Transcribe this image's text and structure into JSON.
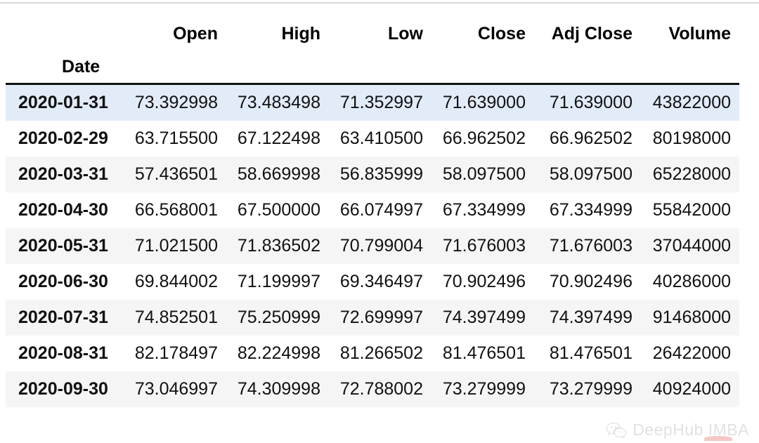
{
  "table": {
    "index_name": "Date",
    "columns": [
      "Open",
      "High",
      "Low",
      "Close",
      "Adj Close",
      "Volume"
    ],
    "rows": [
      {
        "date": "2020-01-31",
        "open": "73.392998",
        "high": "73.483498",
        "low": "71.352997",
        "close": "71.639000",
        "adj_close": "71.639000",
        "volume": "43822000",
        "style": "highlight"
      },
      {
        "date": "2020-02-29",
        "open": "63.715500",
        "high": "67.122498",
        "low": "63.410500",
        "close": "66.962502",
        "adj_close": "66.962502",
        "volume": "80198000",
        "style": "plain"
      },
      {
        "date": "2020-03-31",
        "open": "57.436501",
        "high": "58.669998",
        "low": "56.835999",
        "close": "58.097500",
        "adj_close": "58.097500",
        "volume": "65228000",
        "style": "stripe"
      },
      {
        "date": "2020-04-30",
        "open": "66.568001",
        "high": "67.500000",
        "low": "66.074997",
        "close": "67.334999",
        "adj_close": "67.334999",
        "volume": "55842000",
        "style": "plain"
      },
      {
        "date": "2020-05-31",
        "open": "71.021500",
        "high": "71.836502",
        "low": "70.799004",
        "close": "71.676003",
        "adj_close": "71.676003",
        "volume": "37044000",
        "style": "stripe"
      },
      {
        "date": "2020-06-30",
        "open": "69.844002",
        "high": "71.199997",
        "low": "69.346497",
        "close": "70.902496",
        "adj_close": "70.902496",
        "volume": "40286000",
        "style": "plain"
      },
      {
        "date": "2020-07-31",
        "open": "74.852501",
        "high": "75.250999",
        "low": "72.699997",
        "close": "74.397499",
        "adj_close": "74.397499",
        "volume": "91468000",
        "style": "stripe"
      },
      {
        "date": "2020-08-31",
        "open": "82.178497",
        "high": "82.224998",
        "low": "81.266502",
        "close": "81.476501",
        "adj_close": "81.476501",
        "volume": "26422000",
        "style": "plain"
      },
      {
        "date": "2020-09-30",
        "open": "73.046997",
        "high": "74.309998",
        "low": "72.788002",
        "close": "73.279999",
        "adj_close": "73.279999",
        "volume": "40924000",
        "style": "stripe"
      }
    ]
  },
  "watermark": {
    "text": "DeepHub IMBA",
    "logo": "wechat-icon"
  },
  "colors": {
    "highlight_row": "#e2ebf8",
    "stripe_row": "#f5f5f5",
    "header_rule": "#111111",
    "top_rule": "#d8d8d8",
    "text": "#111111",
    "watermark_text": "#c9c9c9"
  }
}
